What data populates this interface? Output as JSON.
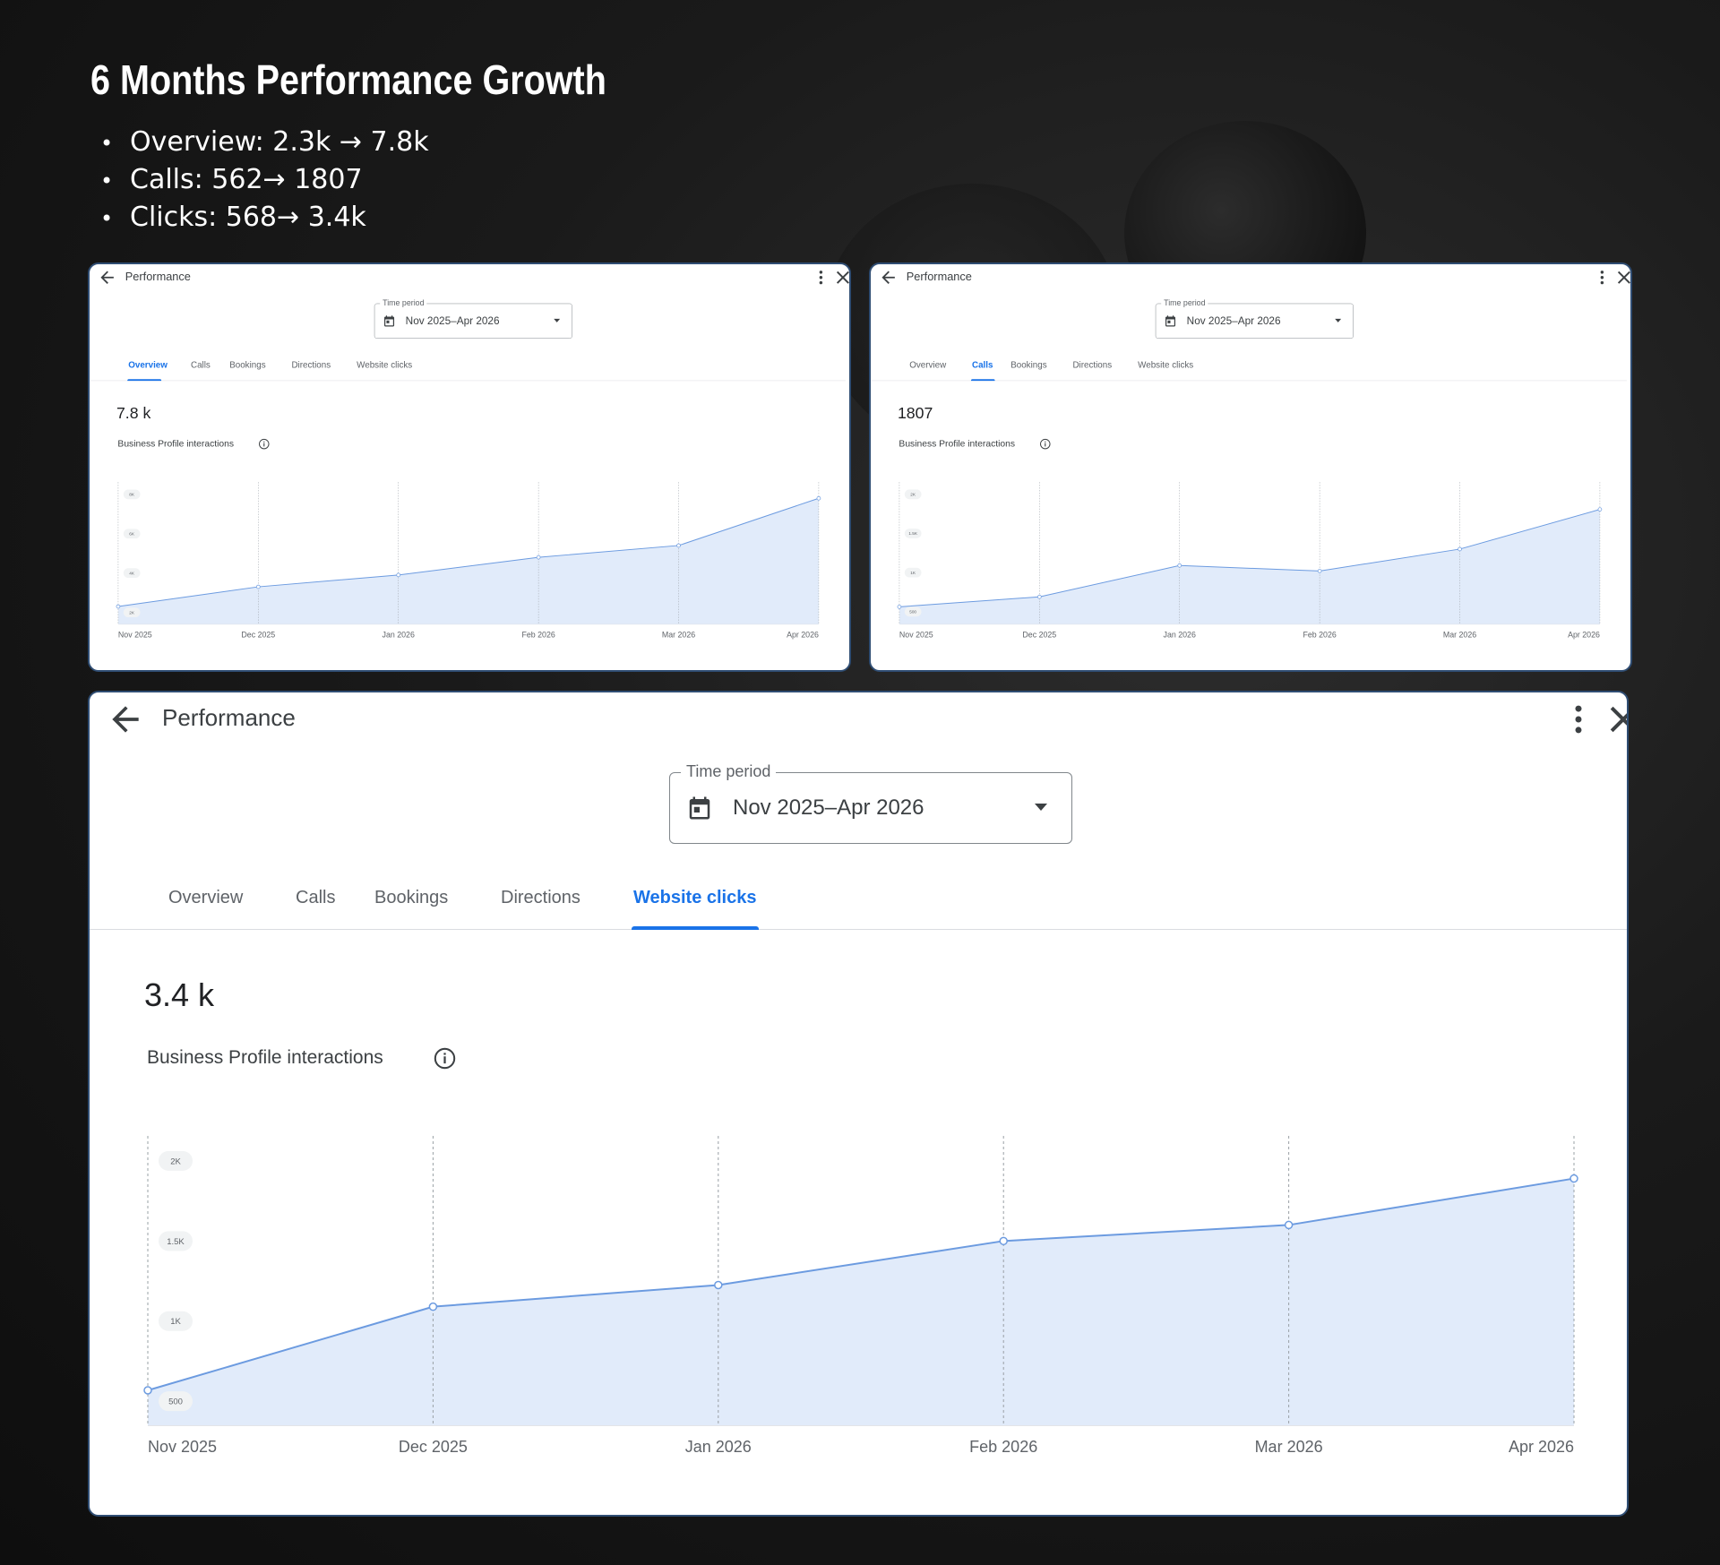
{
  "slide": {
    "heading": "6 Months Performance Growth",
    "bullets": [
      "Overview: 2.3k → 7.8k",
      "Calls: 562→ 1807",
      "Clicks: 568→ 3.4k"
    ]
  },
  "panels": [
    {
      "title": "Performance",
      "time_period_label": "Time period",
      "time_period_value": "Nov 2025–Apr 2026",
      "tabs": [
        "Overview",
        "Calls",
        "Bookings",
        "Directions",
        "Website clicks"
      ],
      "active_tab": 0,
      "metric_value": "7.8 k",
      "metric_label": "Business Profile interactions",
      "icons": [
        "arrow-back-icon",
        "more-vert-icon",
        "close-icon",
        "calendar-icon",
        "dropdown-caret-icon",
        "info-icon"
      ],
      "chart_data": {
        "type": "area",
        "x": [
          "Nov 2025",
          "Dec 2025",
          "Jan 2026",
          "Feb 2026",
          "Mar 2026",
          "Apr 2026"
        ],
        "values": [
          2300,
          3300,
          3900,
          4800,
          5400,
          7800
        ],
        "ylim": [
          1400,
          8400
        ],
        "yticks": [
          2000,
          4000,
          6000,
          8000
        ],
        "ytick_labels": [
          "2K",
          "4K",
          "6K",
          "8K"
        ],
        "grid": "vertical-dashed",
        "color": "#6c9be0",
        "fill": "#e1ebfa"
      }
    },
    {
      "title": "Performance",
      "time_period_label": "Time period",
      "time_period_value": "Nov 2025–Apr 2026",
      "tabs": [
        "Overview",
        "Calls",
        "Bookings",
        "Directions",
        "Website clicks"
      ],
      "active_tab": 1,
      "metric_value": "1807",
      "metric_label": "Business Profile interactions",
      "icons": [
        "arrow-back-icon",
        "more-vert-icon",
        "close-icon",
        "calendar-icon",
        "dropdown-caret-icon",
        "info-icon"
      ],
      "chart_data": {
        "type": "area",
        "x": [
          "Nov 2025",
          "Dec 2025",
          "Jan 2026",
          "Feb 2026",
          "Mar 2026",
          "Apr 2026"
        ],
        "values": [
          562,
          690,
          1090,
          1020,
          1300,
          1807
        ],
        "ylim": [
          340,
          2100
        ],
        "yticks": [
          500,
          1000,
          1500,
          2000
        ],
        "ytick_labels": [
          "500",
          "1K",
          "1.5K",
          "2K"
        ],
        "grid": "vertical-dashed",
        "color": "#6c9be0",
        "fill": "#e1ebfa"
      }
    },
    {
      "title": "Performance",
      "time_period_label": "Time period",
      "time_period_value": "Nov 2025–Apr 2026",
      "tabs": [
        "Overview",
        "Calls",
        "Bookings",
        "Directions",
        "Website clicks"
      ],
      "active_tab": 4,
      "metric_value": "3.4 k",
      "metric_label": "Business Profile interactions",
      "icons": [
        "arrow-back-icon",
        "more-vert-icon",
        "close-icon",
        "calendar-icon",
        "dropdown-caret-icon",
        "info-icon"
      ],
      "chart_data": {
        "type": "area",
        "x": [
          "Nov 2025",
          "Dec 2025",
          "Jan 2026",
          "Feb 2026",
          "Mar 2026",
          "Apr 2026"
        ],
        "values": [
          568,
          1090,
          1225,
          1500,
          1600,
          1890
        ],
        "ylim": [
          350,
          2100
        ],
        "yticks": [
          500,
          1000,
          1500,
          2000
        ],
        "ytick_labels": [
          "500",
          "1K",
          "1.5K",
          "2K"
        ],
        "grid": "vertical-dashed",
        "color": "#6c9be0",
        "fill": "#e1ebfa"
      }
    }
  ]
}
